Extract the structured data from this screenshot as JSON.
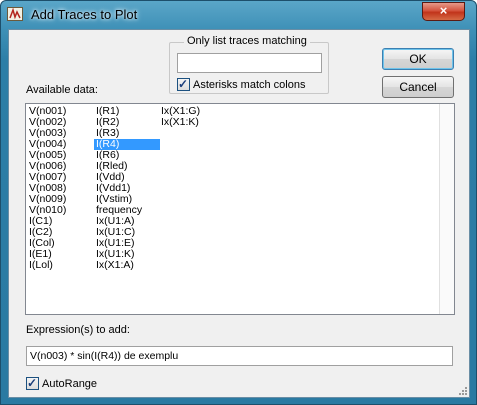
{
  "window": {
    "title": "Add Traces to Plot",
    "close_glyph": "×"
  },
  "filter": {
    "group_label": "Only list traces matching",
    "input_value": "",
    "asterisk_label": "Asterisks match colons",
    "asterisk_checked": true
  },
  "buttons": {
    "ok": "OK",
    "cancel": "Cancel"
  },
  "available_label": "Available data:",
  "available": {
    "col1": [
      "V(n001)",
      "V(n002)",
      "V(n003)",
      "V(n004)",
      "V(n005)",
      "V(n006)",
      "V(n007)",
      "V(n008)",
      "V(n009)",
      "V(n010)",
      "I(C1)",
      "I(C2)",
      "I(Col)",
      "I(E1)",
      "I(Lol)"
    ],
    "col2": [
      "I(R1)",
      "I(R2)",
      "I(R3)",
      "I(R4)",
      "I(R6)",
      "I(Rled)",
      "I(Vdd)",
      "I(Vdd1)",
      "I(Vstim)",
      "frequency",
      "Ix(U1:A)",
      "Ix(U1:C)",
      "Ix(U1:E)",
      "Ix(U1:K)",
      "Ix(X1:A)"
    ],
    "col3": [
      "Ix(X1:G)",
      "Ix(X1:K)"
    ],
    "selected": "I(R4)"
  },
  "expression": {
    "label": "Expression(s) to add:",
    "value": "V(n003) * sin(I(R4)) de exemplu"
  },
  "autorange": {
    "label": "AutoRange",
    "checked": true
  },
  "colors": {
    "title_bar": "#3d8fb6",
    "selection": "#3399ff",
    "dialog_bg": "#f0f0f0"
  }
}
